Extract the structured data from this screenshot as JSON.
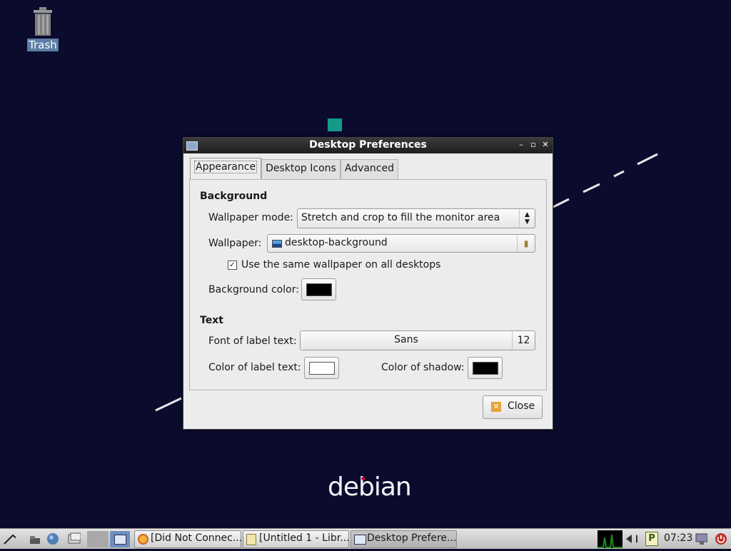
{
  "desktop": {
    "trash_label": "Trash",
    "logo_text": "debian"
  },
  "dialog": {
    "title": "Desktop Preferences",
    "tabs": [
      {
        "label": "Appearance",
        "active": true
      },
      {
        "label": "Desktop Icons",
        "active": false
      },
      {
        "label": "Advanced",
        "active": false
      }
    ],
    "background_section": {
      "title": "Background",
      "wallpaper_mode_label": "Wallpaper mode:",
      "wallpaper_mode_value": "Stretch and crop to fill the monitor area",
      "wallpaper_label": "Wallpaper:",
      "wallpaper_value": "desktop-background",
      "same_wallpaper_label": "Use the same wallpaper on all desktops",
      "same_wallpaper_checked": true,
      "background_color_label": "Background color:",
      "background_color": "#000000"
    },
    "text_section": {
      "title": "Text",
      "font_label": "Font of label text:",
      "font_name": "Sans",
      "font_size": "12",
      "label_color_label": "Color of label text:",
      "label_color": "#ffffff",
      "shadow_color_label": "Color of shadow:",
      "shadow_color": "#000000"
    },
    "close_label": "Close"
  },
  "taskbar": {
    "tasks": [
      {
        "label": "[Did Not Connec...",
        "icon": "firefox-icon"
      },
      {
        "label": "[Untitled 1 - Libr...",
        "icon": "document-icon"
      },
      {
        "label": "Desktop Prefere...",
        "icon": "window-icon",
        "active": true
      }
    ],
    "clock": "07:23"
  },
  "colors": {
    "desktop_bg": "#0b0b2e",
    "accent": "#5c7ea6"
  }
}
